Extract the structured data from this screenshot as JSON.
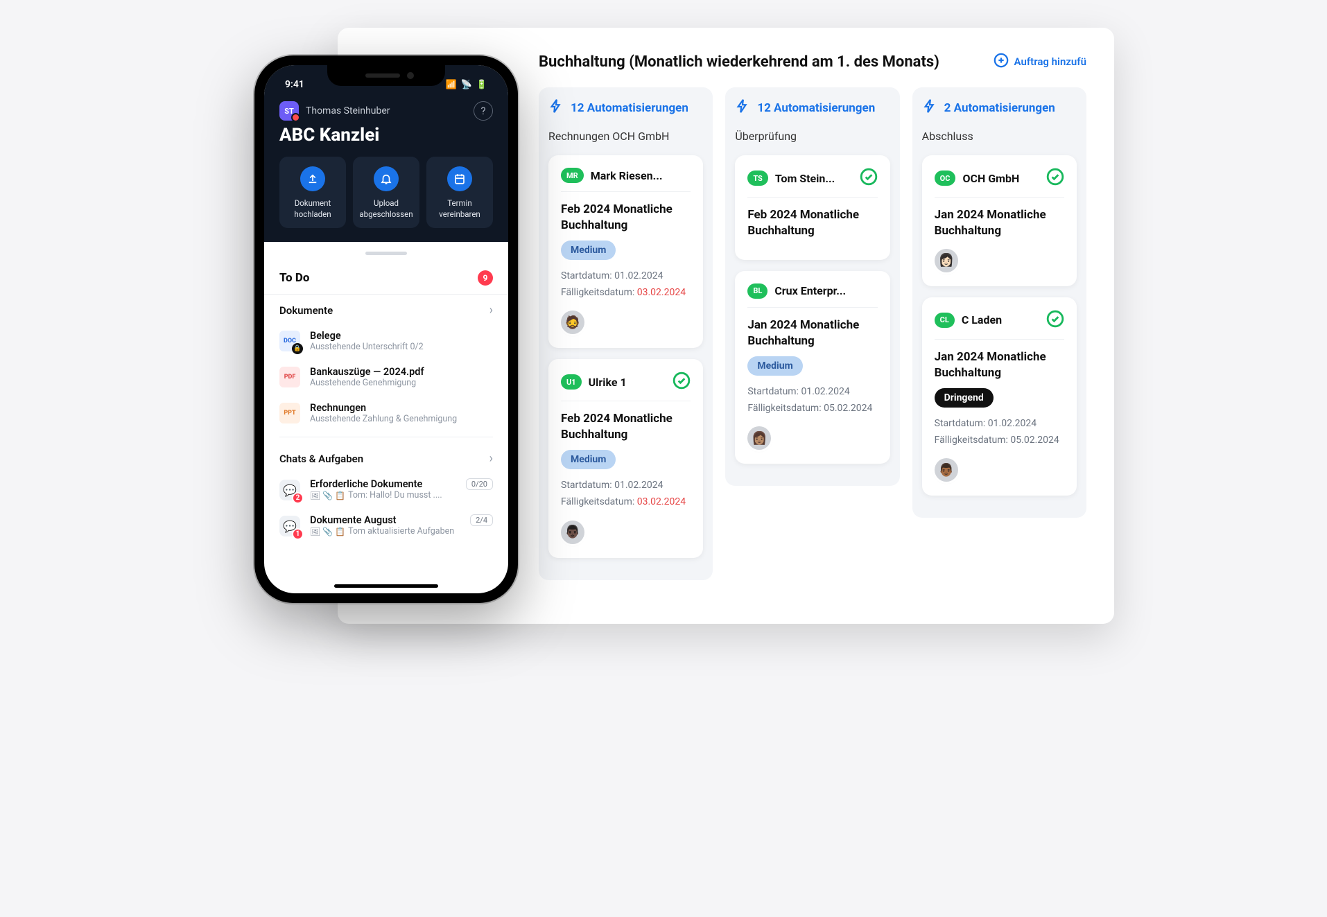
{
  "board": {
    "title": "Buchhaltung (Monatlich wiederkehrend am 1. des Monats)",
    "add_label": "Auftrag hinzufü"
  },
  "columns": [
    {
      "automations": "12 Automatisierungen",
      "name": "Rechnungen OCH GmbH",
      "cards": [
        {
          "chip": "MR",
          "chip_color": "green",
          "assignee": "Mark Riesen...",
          "checked": false,
          "title": "Feb 2024 Monatliche Buchhaltung",
          "priority": "Medium",
          "priority_style": "medium",
          "start_label": "Startdatum:",
          "start": "01.02.2024",
          "due_label": "Fälligkeitsdatum:",
          "due": "03.02.2024",
          "avatar": "🧔"
        },
        {
          "chip": "U1",
          "chip_color": "green",
          "assignee": "Ulrike 1",
          "checked": true,
          "title": "Feb 2024 Monatliche Buchhaltung",
          "priority": "Medium",
          "priority_style": "medium",
          "start_label": "Startdatum:",
          "start": "01.02.2024",
          "due_label": "Fälligkeitsdatum:",
          "due": "03.02.2024",
          "avatar": "👨🏿"
        }
      ]
    },
    {
      "automations": "12 Automatisierungen",
      "name": "Überprüfung",
      "cards": [
        {
          "chip": "TS",
          "chip_color": "green",
          "assignee": "Tom Stein...",
          "checked": true,
          "title": "Feb 2024 Monatliche Buchhaltung"
        },
        {
          "chip": "BL",
          "chip_color": "green",
          "assignee": "Crux Enterpr...",
          "checked": false,
          "title": "Jan 2024 Monatliche Buchhaltung",
          "priority": "Medium",
          "priority_style": "medium",
          "start_label": "Startdatum:",
          "start": "01.02.2024",
          "due_label": "Fälligkeitsdatum:",
          "due": "05.02.2024",
          "due_plain": true,
          "avatar": "👩🏽"
        }
      ]
    },
    {
      "automations": "2 Automatisierungen",
      "name": "Abschluss",
      "cards": [
        {
          "chip": "OC",
          "chip_color": "green",
          "assignee": "OCH GmbH",
          "checked": true,
          "title": "Jan 2024 Monatliche Buchhaltung",
          "avatar": "👩🏻"
        },
        {
          "chip": "CL",
          "chip_color": "green",
          "assignee": "C Laden",
          "checked": true,
          "title": "Jan 2024 Monatliche Buchhaltung",
          "priority": "Dringend",
          "priority_style": "urgent",
          "start_label": "Startdatum:",
          "start": "01.02.2024",
          "due_label": "Fälligkeitsdatum:",
          "due": "05.02.2024",
          "due_plain": true,
          "avatar": "👨🏾"
        }
      ]
    }
  ],
  "phone": {
    "time": "9:41",
    "user_initials": "ST",
    "user_name": "Thomas Steinhuber",
    "org": "ABC Kanzlei",
    "actions": [
      {
        "label": "Dokument hochladen",
        "icon": "upload"
      },
      {
        "label": "Upload abgeschlossen",
        "icon": "bell"
      },
      {
        "label": "Termin vereinbaren",
        "icon": "calendar"
      }
    ],
    "todo_title": "To Do",
    "todo_count": "9",
    "docs_title": "Dokumente",
    "docs": [
      {
        "icon": "doc",
        "title": "Belege",
        "sub": "Ausstehende Unterschrift 0/2",
        "locked": true
      },
      {
        "icon": "pdf",
        "title": "Bankauszüge — 2024.pdf",
        "sub": "Ausstehende Genehmigung"
      },
      {
        "icon": "ppt",
        "title": "Rechnungen",
        "sub": "Ausstehende Zahlung & Genehmigung"
      }
    ],
    "chats_title": "Chats & Aufgaben",
    "chats": [
      {
        "badge": "2",
        "title": "Erforderliche Dokumente",
        "sub": "Tom: Hallo! Du musst ....",
        "count": "0/20"
      },
      {
        "badge": "1",
        "title": "Dokumente August",
        "sub": "Tom aktualisierte Aufgaben",
        "count": "2/4"
      }
    ]
  }
}
